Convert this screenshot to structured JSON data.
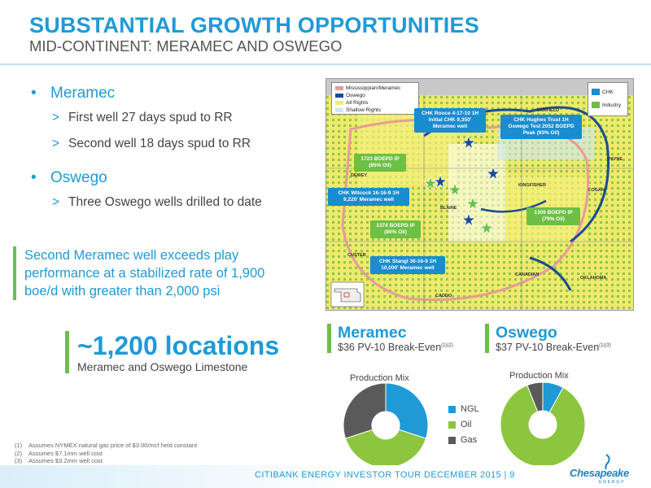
{
  "header": {
    "title": "SUBSTANTIAL GROWTH OPPORTUNITIES",
    "subtitle": "MID-CONTINENT: MERAMEC AND OSWEGO"
  },
  "bullets": [
    {
      "label": "Meramec",
      "subs": [
        "First well 27 days spud to RR",
        "Second well 18 days spud to RR"
      ]
    },
    {
      "label": "Oswego",
      "subs": [
        "Three Oswego wells drilled to date"
      ]
    }
  ],
  "highlight": "Second Meramec well exceeds play performance at a stabilized rate of 1,900 boe/d with greater than 2,000 psi",
  "locations": {
    "big": "~1,200 locations",
    "small": "Meramec and Oswego Limestone"
  },
  "map": {
    "legend": [
      "Mississippian/Meramec",
      "Oswego",
      "All Rights",
      "Shallow Rights"
    ],
    "key": [
      "CHK",
      "Industry"
    ],
    "callouts": {
      "rouce": "CHK Rouce 4-17-10 1H Initial CHK 9,350' Meramec well",
      "hughes": "CHK Hughes Trust 1H Oswego Test 2052 BOEPD Peak (93% Oil)",
      "ip1723": "1723 BOEPD IP (85% Oil)",
      "witcock": "CHK Witcock 16-16-9 1H 9,220' Meramec well",
      "ip1309": "1309 BOEPD IP (79% Oil)",
      "ip1374": "1374 BOEPD IP (80% Oil)",
      "stangl": "CHK Stangl 36-16-9 1H 10,000' Meramec well"
    },
    "counties": [
      "GARFIELD",
      "PAYNE",
      "LOGAN",
      "KINGFISHER",
      "BLAINE",
      "DEWEY",
      "CUSTER",
      "CANADIAN",
      "OKLAHOMA",
      "CADDO"
    ]
  },
  "meramec": {
    "name": "Meramec",
    "breakeven": "$36 PV-10 Break-Even",
    "breakeven_sup": "(1)(2)",
    "mix_label": "Production Mix"
  },
  "oswego": {
    "name": "Oswego",
    "breakeven": "$37 PV-10 Break-Even",
    "breakeven_sup": "(1)(3)",
    "mix_label": "Production Mix"
  },
  "pie_legend": [
    "NGL",
    "Oil",
    "Gas"
  ],
  "colors": {
    "ngl": "#1f9ad6",
    "oil": "#8cc63f",
    "gas": "#5a5a5a",
    "accent": "#1f9ad6",
    "green": "#6dbf45"
  },
  "chart_data": [
    {
      "type": "pie",
      "title": "Production Mix",
      "categories": [
        "NGL",
        "Oil",
        "Gas"
      ],
      "values": [
        30,
        40,
        30
      ]
    },
    {
      "type": "pie",
      "title": "Production Mix",
      "categories": [
        "NGL",
        "Oil",
        "Gas"
      ],
      "values": [
        8,
        86,
        6
      ]
    }
  ],
  "footnotes": [
    {
      "n": "(1)",
      "text": "Assumes NYMEX natural gas price of $3.00/mcf held constant"
    },
    {
      "n": "(2)",
      "text": "Assumes $7.1mm well cost"
    },
    {
      "n": "(3)",
      "text": "Assumes $3.2mm well cost"
    }
  ],
  "footer": {
    "text": "CITIBANK ENERGY INVESTOR TOUR DECEMBER 2015  |  9"
  },
  "logo": {
    "name": "Chesapeake",
    "sub": "ENERGY"
  }
}
